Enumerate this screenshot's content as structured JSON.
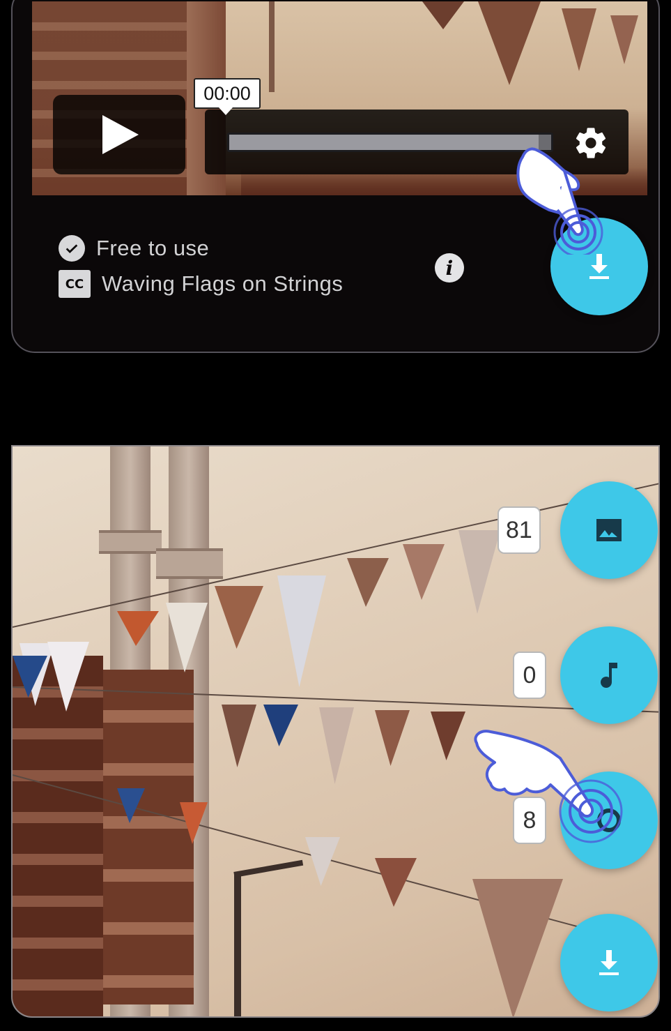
{
  "player": {
    "time": "00:00",
    "progress": 0.96
  },
  "info": {
    "license": "Free to use",
    "title": "Waving Flags on Strings"
  },
  "actions": {
    "images_count": "81",
    "audio_count": "0",
    "third_count": "8"
  },
  "icons": {
    "play": "play-icon",
    "settings": "gear-icon",
    "license": "check-circle-icon",
    "captions": "cc-icon",
    "info": "info-icon",
    "download": "download-icon",
    "image": "image-icon",
    "music": "music-note-icon",
    "pointer": "pointing-hand-icon"
  },
  "colors": {
    "accent": "#3ec8e8",
    "card_bg": "#0b0809",
    "hand": "#4c5cd8"
  }
}
